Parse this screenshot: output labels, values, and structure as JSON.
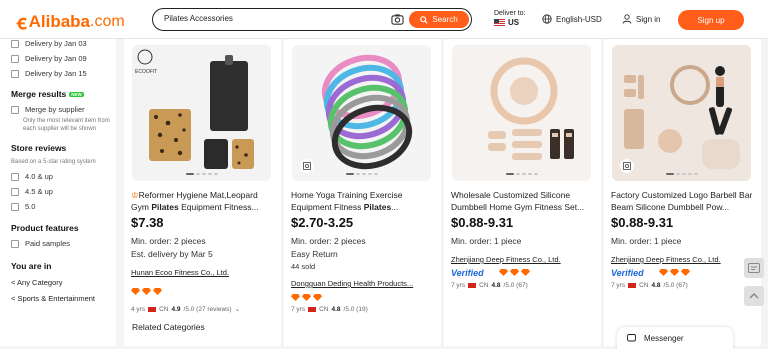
{
  "header": {
    "logo_text": "Alibaba",
    "logo_suffix": ".com",
    "search_query": "Pilates Accessories",
    "search_button": "Search",
    "deliver_label": "Deliver to:",
    "deliver_country": "US",
    "language": "English-USD",
    "signin": "Sign in",
    "signup": "Sign up"
  },
  "sidebar": {
    "delivery_options": [
      "Delivery by Jan 03",
      "Delivery by Jan 09",
      "Delivery by Jan 15"
    ],
    "merge_title": "Merge results",
    "merge_badge": "NEW",
    "merge_option": "Merge by supplier",
    "merge_note": "Only the most relevant item from each supplier will be shown",
    "reviews_title": "Store reviews",
    "reviews_note": "Based on a 5-star rating system",
    "review_options": [
      "4.0 & up",
      "4.5 & up",
      "5.0"
    ],
    "features_title": "Product features",
    "features_option": "Paid samples",
    "you_are_in": "You are in",
    "crumbs": [
      "< Any Category",
      "< Sports & Entertainment"
    ]
  },
  "products": [
    {
      "brand": "ECOOFIT",
      "title_pre": "Reformer Hygiene Mat,Leopard Gym ",
      "title_bold": "Pilates",
      "title_post": " Equipment Fitness...",
      "price": "$7.38",
      "min_order": "Min. order: 2 pieces",
      "extra": "Est. delivery by Mar 5",
      "supplier": "Hunan Ecoo Fitness Co., Ltd.",
      "years": "4 yrs",
      "country": "CN",
      "score": "4.9",
      "score_detail": "/5.0 (27 reviews)"
    },
    {
      "title_pre": "Home Yoga Training Exercise Equipment Fitness ",
      "title_bold": "Pilates",
      "title_post": "...",
      "price": "$2.70-3.25",
      "min_order": "Min. order: 2 pieces",
      "extra": "Easy Return",
      "sold": "44 sold",
      "supplier": "Dongguan Deding Health Products...",
      "years": "7 yrs",
      "country": "CN",
      "score": "4.8",
      "score_detail": "/5.0 (19)"
    },
    {
      "title_pre": "Wholesale Customized Silicone Dumbbell Home Gym Fitness Set...",
      "title_bold": "",
      "title_post": "",
      "price": "$0.88-9.31",
      "min_order": "Min. order: 1 piece",
      "supplier": "Zhenjiang Deep Fitness Co., Ltd.",
      "verified": "Verified",
      "years": "7 yrs",
      "country": "CN",
      "score": "4.8",
      "score_detail": "/5.0 (67)"
    },
    {
      "title_pre": "Factory Customized Logo Barbell Bar Beam Silicone Dumbbell Pow...",
      "title_bold": "",
      "title_post": "",
      "price": "$0.88-9.31",
      "min_order": "Min. order: 1 piece",
      "supplier": "Zhenjiang Deep Fitness Co., Ltd.",
      "verified": "Verified",
      "years": "7 yrs",
      "country": "CN",
      "score": "4.8",
      "score_detail": "/5.0 (67)"
    }
  ],
  "related_categories": "Related Categories",
  "messenger": "Messenger",
  "colors": {
    "accent": "#ff5e1a",
    "verified": "#1a64d6"
  }
}
